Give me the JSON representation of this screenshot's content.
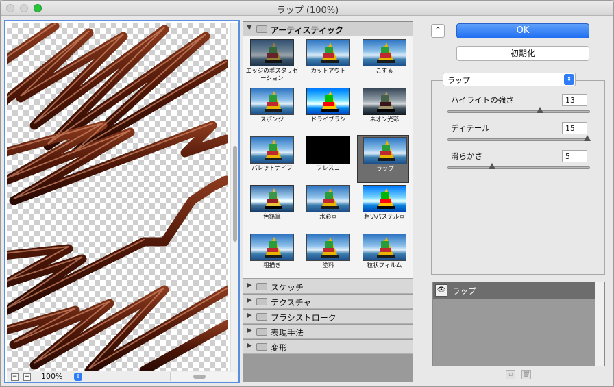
{
  "window": {
    "title": "ラップ (100%)"
  },
  "preview": {
    "zoom": "100%",
    "zoom_out": "−",
    "zoom_in": "+"
  },
  "gallery": {
    "open_category": "アーティスティック",
    "filters": [
      "エッジのポスタリゼーション",
      "カットアウト",
      "こする",
      "スポンジ",
      "ドライブラシ",
      "ネオン光彩",
      "パレットナイフ",
      "フレスコ",
      "ラップ",
      "色鉛筆",
      "水彩画",
      "粗いパステル画",
      "粗描き",
      "塗料",
      "粒状フィルム"
    ],
    "selected_filter": "ラップ",
    "closed_categories": [
      "スケッチ",
      "テクスチャ",
      "ブラシストローク",
      "表現手法",
      "変形"
    ]
  },
  "actions": {
    "ok": "OK",
    "reset": "初期化",
    "collapse": "^"
  },
  "settings": {
    "filter_name": "ラップ",
    "params": [
      {
        "label": "ハイライトの強さ",
        "value": "13",
        "level": 0.65
      },
      {
        "label": "ディテール",
        "value": "15",
        "level": 1.0
      },
      {
        "label": "滑らかさ",
        "value": "5",
        "level": 0.3
      }
    ]
  },
  "layers": {
    "items": [
      {
        "name": "ラップ",
        "eye": "👁"
      }
    ]
  },
  "colors": {
    "accent": "#1f6ff2",
    "chocolate": "#5a1d0e"
  }
}
